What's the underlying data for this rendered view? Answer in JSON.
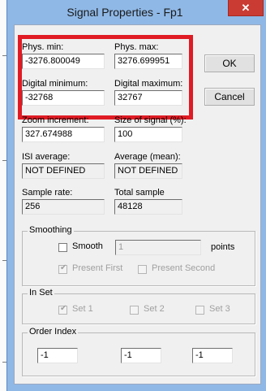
{
  "window": {
    "title": "Signal Properties - Fp1",
    "close_glyph": "✕"
  },
  "fields": {
    "phys_min": {
      "label": "Phys. min:",
      "value": "-3276.800049"
    },
    "phys_max": {
      "label": "Phys. max:",
      "value": "3276.699951"
    },
    "digital_min": {
      "label": "Digital minimum:",
      "value": "-32768"
    },
    "digital_max": {
      "label": "Digital maximum:",
      "value": "32767"
    },
    "zoom_increment": {
      "label": "Zoom increment:",
      "value": "327.674988"
    },
    "size_of_signal": {
      "label": "Size of signal (%):",
      "value": "100"
    },
    "isi_average": {
      "label": "ISI average:",
      "value": "NOT DEFINED"
    },
    "average_mean": {
      "label": "Average (mean):",
      "value": "NOT DEFINED"
    },
    "sample_rate": {
      "label": "Sample rate:",
      "value": "256"
    },
    "total_sample": {
      "label": "Total sample",
      "value": "48128"
    }
  },
  "buttons": {
    "ok": "OK",
    "cancel": "Cancel"
  },
  "smoothing": {
    "title": "Smoothing",
    "smooth_label": "Smooth",
    "smooth_checked": false,
    "points_value": "1",
    "points_label": "points",
    "present_first_label": "Present First",
    "present_first_checked": true,
    "present_second_label": "Present Second",
    "present_second_checked": false
  },
  "in_set": {
    "title": "In Set",
    "set1_label": "Set 1",
    "set1_checked": true,
    "set2_label": "Set 2",
    "set2_checked": false,
    "set3_label": "Set 3",
    "set3_checked": false
  },
  "order_index": {
    "title": "Order Index",
    "values": [
      "-1",
      "-1",
      "-1"
    ]
  },
  "colors": {
    "highlight": "#e01b24",
    "title_bar": "#8fb8e6",
    "close_button": "#c93b33"
  }
}
